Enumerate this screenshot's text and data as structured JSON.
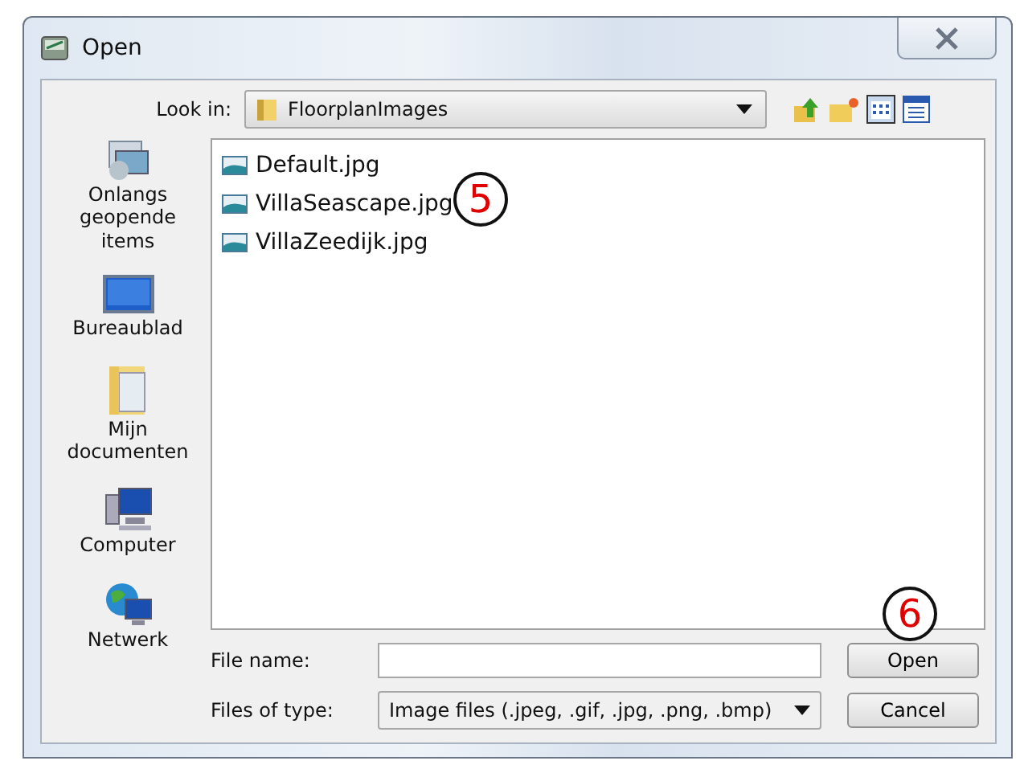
{
  "window": {
    "title": "Open"
  },
  "look_in": {
    "label": "Look in:",
    "value": "FloorplanImages"
  },
  "places": [
    {
      "label": "Onlangs geopende items",
      "kind": "recent"
    },
    {
      "label": "Bureaublad",
      "kind": "desktop"
    },
    {
      "label": "Mijn documenten",
      "kind": "documents"
    },
    {
      "label": "Computer",
      "kind": "computer"
    },
    {
      "label": "Netwerk",
      "kind": "network"
    }
  ],
  "files": [
    {
      "name": "Default.jpg"
    },
    {
      "name": "VillaSeascape.jpg"
    },
    {
      "name": "VillaZeedijk.jpg"
    }
  ],
  "file_name": {
    "label": "File name:"
  },
  "file_type": {
    "label": "Files of type:",
    "value": "Image files (.jpeg, .gif, .jpg, .png, .bmp)"
  },
  "buttons": [
    "Open",
    "Cancel"
  ],
  "file_list_callout": "5",
  "open_button_callout": "6"
}
